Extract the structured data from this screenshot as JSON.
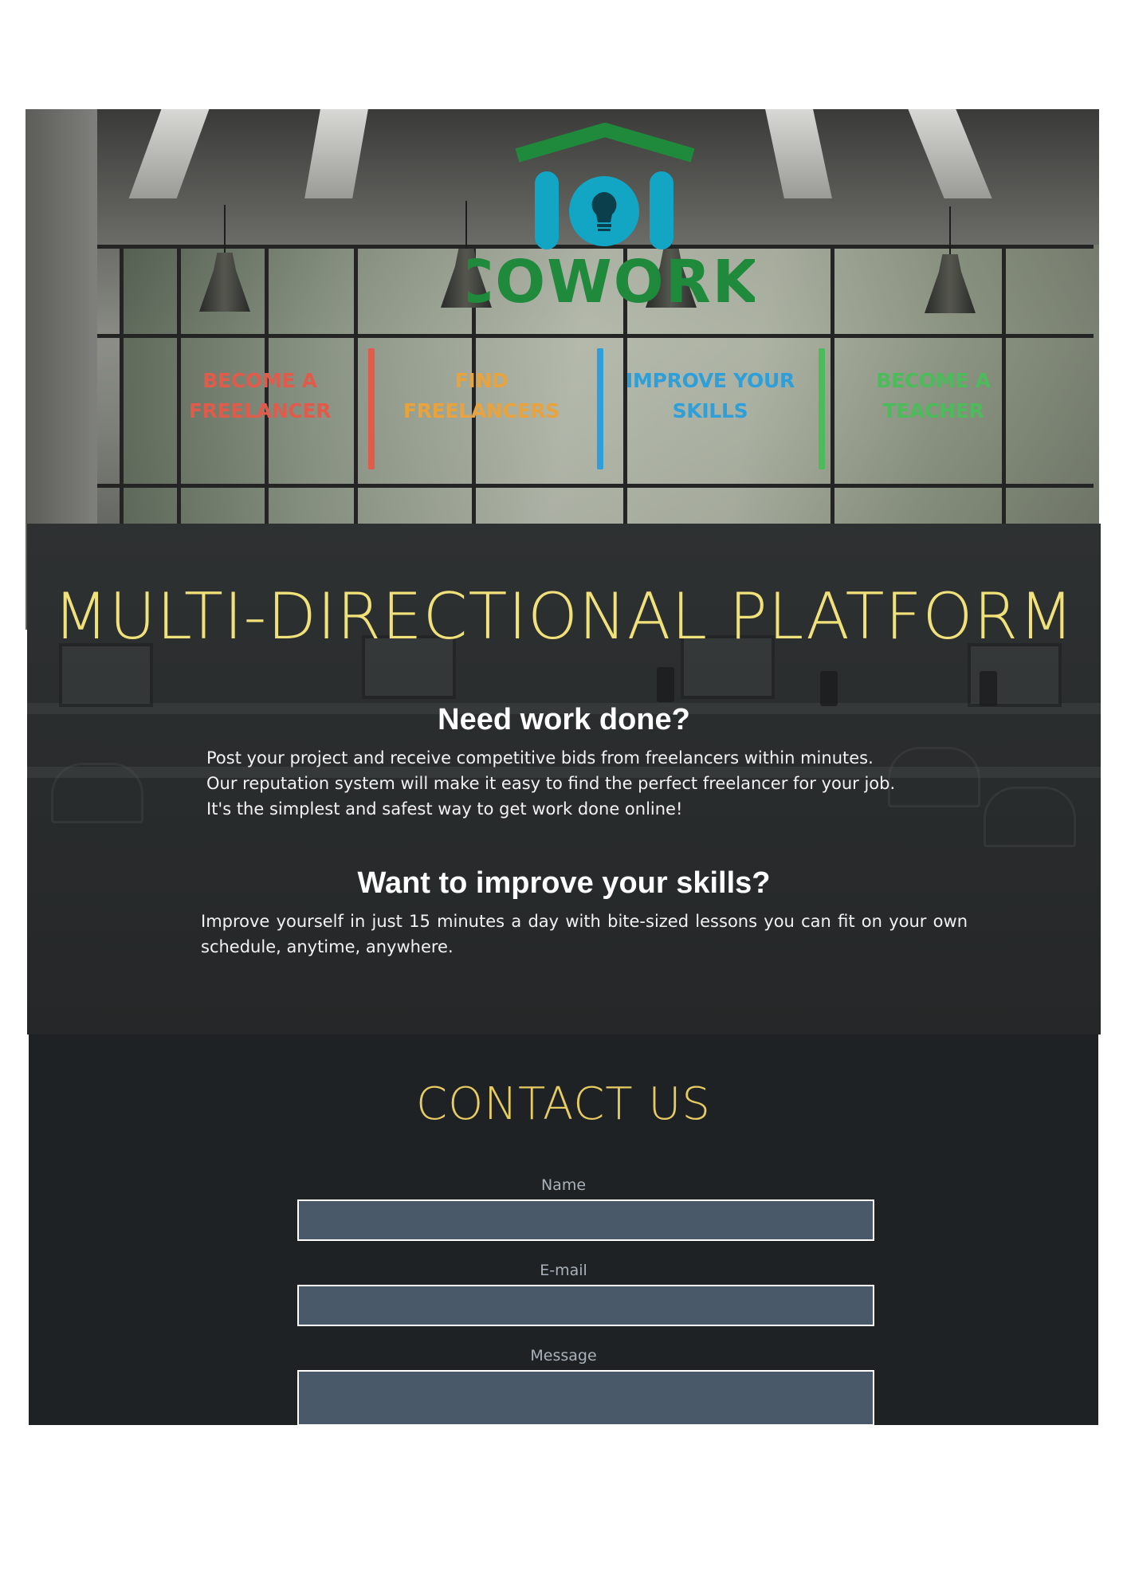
{
  "brand": {
    "logo_text": "COWORK",
    "colors": {
      "green": "#1f8a3c",
      "blue": "#12a5c4"
    }
  },
  "nav": {
    "items": [
      {
        "line1": "BECOME A",
        "line2": "FREELANCER",
        "color": "#e25a4a"
      },
      {
        "line1": "FIND",
        "line2": "FREELANCERS",
        "color": "#e9a33d"
      },
      {
        "line1": "IMPROVE YOUR",
        "line2": "SKILLS",
        "color": "#2e9fd8"
      },
      {
        "line1": "BECOME A",
        "line2": "TEACHER",
        "color": "#4cbb5a"
      }
    ]
  },
  "platform": {
    "title": "MULTI-DIRECTIONAL PLATFORM",
    "sections": [
      {
        "heading": "Need work done?",
        "lines": [
          "Post your project and receive competitive bids from freelancers within minutes.",
          "Our reputation system will make it easy to find the perfect freelancer for your job.",
          "It's the simplest and safest way to get work done online!"
        ]
      },
      {
        "heading": "Want to improve your skills?",
        "text": "Improve yourself in just 15 minutes a day with bite-sized lessons you can fit on your own schedule, anytime, anywhere."
      }
    ],
    "title_color": "#f1e17a"
  },
  "contact": {
    "title": "CONTACT US",
    "fields": {
      "name": {
        "label": "Name",
        "value": ""
      },
      "email": {
        "label": "E-mail",
        "value": ""
      },
      "message": {
        "label": "Message",
        "value": ""
      }
    },
    "accent": "#e6cc62"
  }
}
